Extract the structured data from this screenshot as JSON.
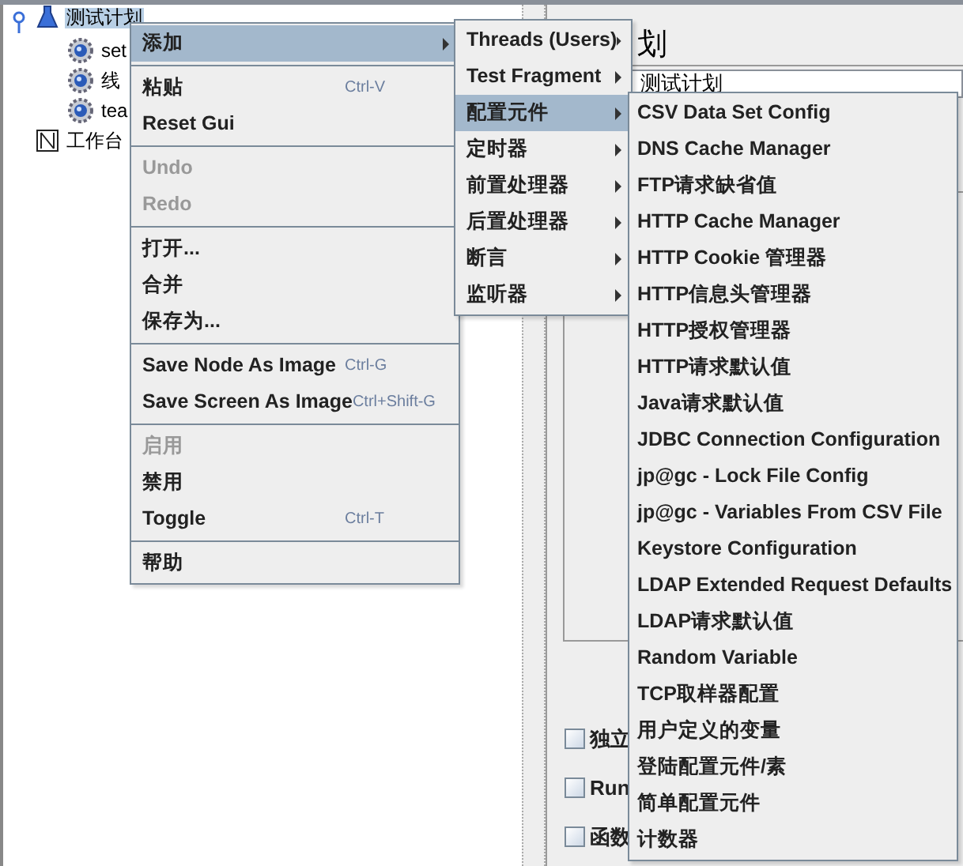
{
  "tree": {
    "items": [
      {
        "label": "测试计划",
        "kind": "plan",
        "selected": true,
        "children": [
          {
            "label": "set",
            "kind": "thread",
            "selected": false
          },
          {
            "label": "线",
            "kind": "thread",
            "selected": false
          },
          {
            "label": "tea",
            "kind": "thread",
            "selected": false
          }
        ]
      },
      {
        "label": "工作台",
        "kind": "workbench",
        "selected": false
      }
    ]
  },
  "panel": {
    "title": "划",
    "name_value": "测试计划",
    "checkboxes": [
      {
        "label": "独立",
        "checked": false
      },
      {
        "label": "Run",
        "checked": false
      },
      {
        "label": "函数",
        "checked": false
      }
    ]
  },
  "context_menu": {
    "items": [
      {
        "kind": "item",
        "label": "添加",
        "selected": true,
        "disabled": false,
        "submenu": true
      },
      {
        "kind": "separator"
      },
      {
        "kind": "item",
        "label": "粘贴",
        "shortcut": "Ctrl-V",
        "selected": false,
        "disabled": false,
        "submenu": false
      },
      {
        "kind": "item",
        "label": "Reset Gui",
        "selected": false,
        "disabled": false,
        "submenu": false
      },
      {
        "kind": "separator"
      },
      {
        "kind": "item",
        "label": "Undo",
        "selected": false,
        "disabled": true,
        "submenu": false
      },
      {
        "kind": "item",
        "label": "Redo",
        "selected": false,
        "disabled": true,
        "submenu": false
      },
      {
        "kind": "separator"
      },
      {
        "kind": "item",
        "label": "打开...",
        "selected": false,
        "disabled": false,
        "submenu": false
      },
      {
        "kind": "item",
        "label": "合并",
        "selected": false,
        "disabled": false,
        "submenu": false
      },
      {
        "kind": "item",
        "label": "保存为...",
        "selected": false,
        "disabled": false,
        "submenu": false
      },
      {
        "kind": "separator"
      },
      {
        "kind": "item",
        "label": "Save Node As Image",
        "shortcut": "Ctrl-G",
        "selected": false,
        "disabled": false,
        "submenu": false
      },
      {
        "kind": "item",
        "label": "Save Screen As Image",
        "shortcut": "Ctrl+Shift-G",
        "selected": false,
        "disabled": false,
        "submenu": false
      },
      {
        "kind": "separator"
      },
      {
        "kind": "item",
        "label": "启用",
        "selected": false,
        "disabled": true,
        "submenu": false
      },
      {
        "kind": "item",
        "label": "禁用",
        "selected": false,
        "disabled": false,
        "submenu": false
      },
      {
        "kind": "item",
        "label": "Toggle",
        "shortcut": "Ctrl-T",
        "selected": false,
        "disabled": false,
        "submenu": false
      },
      {
        "kind": "separator"
      },
      {
        "kind": "item",
        "label": "帮助",
        "selected": false,
        "disabled": false,
        "submenu": false
      }
    ]
  },
  "add_submenu": {
    "items": [
      {
        "label": "Threads (Users)",
        "selected": false,
        "submenu": true
      },
      {
        "label": "Test Fragment",
        "selected": false,
        "submenu": true
      },
      {
        "label": "配置元件",
        "selected": true,
        "submenu": true
      },
      {
        "label": "定时器",
        "selected": false,
        "submenu": true
      },
      {
        "label": "前置处理器",
        "selected": false,
        "submenu": true
      },
      {
        "label": "后置处理器",
        "selected": false,
        "submenu": true
      },
      {
        "label": "断言",
        "selected": false,
        "submenu": true
      },
      {
        "label": "监听器",
        "selected": false,
        "submenu": true
      }
    ]
  },
  "config_submenu": {
    "items": [
      {
        "label": "CSV Data Set Config",
        "selected": false
      },
      {
        "label": "DNS Cache Manager",
        "selected": false
      },
      {
        "label": "FTP请求缺省值",
        "selected": false
      },
      {
        "label": "HTTP Cache Manager",
        "selected": false
      },
      {
        "label": "HTTP Cookie 管理器",
        "selected": false
      },
      {
        "label": "HTTP信息头管理器",
        "selected": false
      },
      {
        "label": "HTTP授权管理器",
        "selected": false
      },
      {
        "label": "HTTP请求默认值",
        "selected": false
      },
      {
        "label": "Java请求默认值",
        "selected": false
      },
      {
        "label": "JDBC Connection Configuration",
        "selected": false
      },
      {
        "label": "jp@gc - Lock File Config",
        "selected": false
      },
      {
        "label": "jp@gc - Variables From CSV File",
        "selected": false
      },
      {
        "label": "Keystore Configuration",
        "selected": false
      },
      {
        "label": "LDAP Extended Request Defaults",
        "selected": false
      },
      {
        "label": "LDAP请求默认值",
        "selected": false
      },
      {
        "label": "Random Variable",
        "selected": false
      },
      {
        "label": "TCP取样器配置",
        "selected": false
      },
      {
        "label": "用户定义的变量",
        "selected": false
      },
      {
        "label": "登陆配置元件/素",
        "selected": false
      },
      {
        "label": "简单配置元件",
        "selected": false
      },
      {
        "label": "计数器",
        "selected": false
      }
    ]
  }
}
